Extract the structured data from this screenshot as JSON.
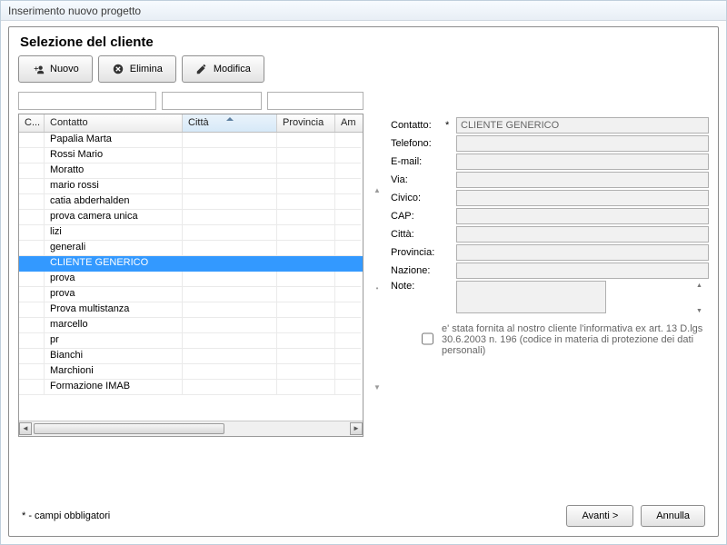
{
  "window": {
    "title": "Inserimento nuovo progetto"
  },
  "section": {
    "title": "Selezione del cliente"
  },
  "toolbar": {
    "nuovo": "Nuovo",
    "elimina": "Elimina",
    "modifica": "Modifica"
  },
  "grid": {
    "columns": {
      "codice": "C...",
      "contatto": "Contatto",
      "citta": "Città",
      "provincia": "Provincia",
      "ambiente": "Am"
    },
    "rows": [
      {
        "contatto": "Papalia Marta"
      },
      {
        "contatto": "Rossi Mario"
      },
      {
        "contatto": "Moratto"
      },
      {
        "contatto": "mario rossi"
      },
      {
        "contatto": "catia abderhalden"
      },
      {
        "contatto": "prova camera unica"
      },
      {
        "contatto": "lizi"
      },
      {
        "contatto": "generali"
      },
      {
        "contatto": "CLIENTE GENERICO",
        "selected": true
      },
      {
        "contatto": "prova"
      },
      {
        "contatto": "prova"
      },
      {
        "contatto": "Prova multistanza"
      },
      {
        "contatto": "marcello"
      },
      {
        "contatto": "pr"
      },
      {
        "contatto": "Bianchi"
      },
      {
        "contatto": "Marchioni"
      },
      {
        "contatto": "Formazione IMAB"
      }
    ]
  },
  "form": {
    "labels": {
      "contatto": "Contatto:",
      "telefono": "Telefono:",
      "email": "E-mail:",
      "via": "Via:",
      "civico": "Civico:",
      "cap": "CAP:",
      "citta": "Città:",
      "provincia": "Provincia:",
      "nazione": "Nazione:",
      "note": "Note:"
    },
    "required_mark": "*",
    "values": {
      "contatto": "CLIENTE GENERICO"
    },
    "consent": "e' stata fornita al nostro cliente l'informativa ex art. 13 D.lgs 30.6.2003 n. 196 (codice in materia di protezione dei dati personali)"
  },
  "footer": {
    "note": "* - campi obbligatori",
    "avanti": "Avanti >",
    "annulla": "Annulla"
  }
}
